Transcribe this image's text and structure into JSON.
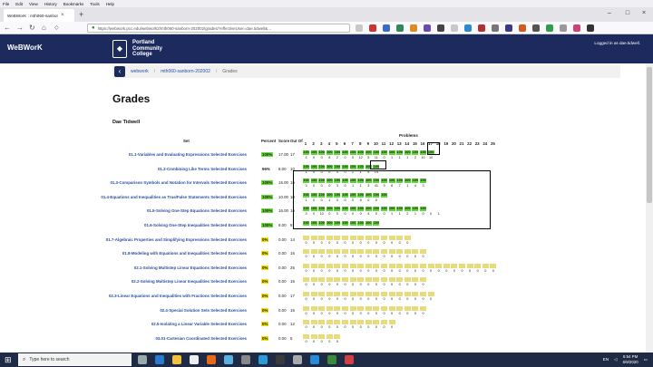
{
  "browser": {
    "menu": [
      "File",
      "Edit",
      "View",
      "History",
      "Bookmarks",
      "Tools",
      "Help"
    ],
    "tab_title": "WeBWorK : mth060-sanborn-2…",
    "url": "https://webwork.pcc.edu/webwork2/mth060-sanborn-202002/grades/?effectiveUser=dae.tidwell&…"
  },
  "header": {
    "app_name": "WeBWorK",
    "college": "Portland Community College",
    "logged_in": "Logged in as dae.tidwell."
  },
  "breadcrumb": {
    "home": "webwork",
    "course": "mth060-sanborn-202002",
    "current": "Grades"
  },
  "page": {
    "title": "Grades",
    "student": "Dae Tidwell",
    "problems_label": "Problems",
    "col_set": "Set",
    "col_percent": "Percent",
    "col_score": "Score",
    "col_outof": "Out Of",
    "problem_numbers": [
      "1",
      "2",
      "3",
      "4",
      "5",
      "6",
      "7",
      "8",
      "9",
      "10",
      "11",
      "12",
      "13",
      "14",
      "15",
      "16",
      "17",
      "18",
      "19",
      "20",
      "21",
      "22",
      "23",
      "24",
      "25"
    ]
  },
  "sets": [
    {
      "name": "01.1-Variables and Evaluating Expressions Selected Exercises",
      "pct": "100%",
      "score": "17.00",
      "outof": "17",
      "status": "hi",
      "row1": [
        "100",
        "100",
        "100",
        "100",
        "100",
        "100",
        "100",
        "100",
        "100",
        "100",
        "100",
        "100",
        "100",
        "100",
        "100",
        "100",
        "100"
      ],
      "row2": [
        "4",
        "0",
        "0",
        "8",
        "2",
        "0",
        "0",
        "12",
        "5",
        "11",
        "0",
        "1",
        "1",
        "1",
        "2",
        "10",
        "10"
      ]
    },
    {
      "name": "01.2-Combining Like Terms Selected Exercises",
      "pct": "96%",
      "score": "8.00",
      "outof": "10",
      "status": "mid",
      "row1": [
        "100",
        "100",
        "100",
        "100",
        "100",
        "100",
        "100",
        "100",
        "100",
        "100"
      ],
      "row2": [
        "1",
        "0",
        "0",
        "0",
        "0",
        "0",
        "2",
        "1",
        "5",
        "14"
      ]
    },
    {
      "name": "01.3-Comparison Symbols and Notation for Intervals Selected Exercises",
      "pct": "100%",
      "score": "16.00",
      "outof": "16",
      "status": "hi",
      "row1": [
        "100",
        "100",
        "100",
        "100",
        "100",
        "100",
        "100",
        "100",
        "100",
        "100",
        "100",
        "100",
        "100",
        "100",
        "100",
        "100"
      ],
      "row2": [
        "3",
        "0",
        "0",
        "0",
        "3",
        "0",
        "1",
        "1",
        "3",
        "41",
        "9",
        "8",
        "7",
        "1",
        "4",
        "3"
      ]
    },
    {
      "name": "01.4-Equations and Inequalities as True/False Statements Selected Exercises",
      "pct": "100%",
      "score": "10.00",
      "outof": "10",
      "status": "hi",
      "row1": [
        "100",
        "100",
        "100",
        "100",
        "100",
        "100",
        "100",
        "100",
        "100",
        "100",
        "100"
      ],
      "row2": [
        "1",
        "0",
        "0",
        "1",
        "0",
        "0",
        "0",
        "8",
        "0",
        "0"
      ]
    },
    {
      "name": "01.5-Solving One-Step Equations Selected Exercises",
      "pct": "100%",
      "score": "16.00",
      "outof": "16",
      "status": "hi",
      "row1": [
        "100",
        "100",
        "100",
        "100",
        "100",
        "100",
        "100",
        "100",
        "100",
        "100",
        "100",
        "100",
        "100",
        "100",
        "100",
        "100"
      ],
      "row2": [
        "3",
        "0",
        "10",
        "0",
        "0",
        "0",
        "0",
        "0",
        "4",
        "0",
        "0",
        "1",
        "1",
        "2",
        "1",
        "0",
        "0",
        "1"
      ]
    },
    {
      "name": "01.6-Solving One-Step Inequalities Selected Exercises",
      "pct": "100%",
      "score": "8.00",
      "outof": "8",
      "status": "hi",
      "row1": [
        "100",
        "100",
        "100",
        "100",
        "100",
        "100",
        "100",
        "100",
        "100",
        "100"
      ],
      "row2": []
    },
    {
      "name": "01.7-Algebraic Properties and Simplifying Expressions Selected Exercises",
      "pct": "0%",
      "score": "0.00",
      "outof": "14",
      "status": "lo",
      "row1": [
        "",
        "",
        "",
        "",
        "",
        "",
        "",
        "",
        "",
        "",
        "",
        "",
        "",
        ""
      ],
      "row2": [
        "0",
        "0",
        "0",
        "0",
        "0",
        "0",
        "0",
        "0",
        "0",
        "0",
        "0",
        "0",
        "0",
        "0"
      ]
    },
    {
      "name": "01.8-Modeling with Equations and Inequalities Selected Exercises",
      "pct": "0%",
      "score": "0.00",
      "outof": "16",
      "status": "lo",
      "row1": [
        "",
        "",
        "",
        "",
        "",
        "",
        "",
        "",
        "",
        "",
        "",
        "",
        "",
        "",
        "",
        ""
      ],
      "row2": [
        "0",
        "0",
        "0",
        "0",
        "0",
        "0",
        "0",
        "0",
        "0",
        "0",
        "0",
        "0",
        "0",
        "0",
        "0",
        "0"
      ]
    },
    {
      "name": "02.1-Solving Multistep Linear Equations Selected Exercises",
      "pct": "0%",
      "score": "0.00",
      "outof": "25",
      "status": "lo",
      "row1": [
        "",
        "",
        "",
        "",
        "",
        "",
        "",
        "",
        "",
        "",
        "",
        "",
        "",
        "",
        "",
        "",
        "",
        "",
        "",
        "",
        "",
        "",
        "",
        "",
        ""
      ],
      "row2": [
        "0",
        "0",
        "0",
        "0",
        "0",
        "0",
        "0",
        "0",
        "0",
        "0",
        "0",
        "0",
        "0",
        "0",
        "0",
        "0",
        "0",
        "0",
        "0",
        "0",
        "0",
        "0",
        "0",
        "0",
        "0"
      ]
    },
    {
      "name": "02.2-Solving Multistep Linear Inequalities Selected Exercises",
      "pct": "0%",
      "score": "0.00",
      "outof": "16",
      "status": "lo",
      "row1": [
        "",
        "",
        "",
        "",
        "",
        "",
        "",
        "",
        "",
        "",
        "",
        "",
        "",
        "",
        "",
        ""
      ],
      "row2": [
        "0",
        "0",
        "0",
        "0",
        "0",
        "0",
        "0",
        "0",
        "0",
        "0",
        "0",
        "0",
        "0",
        "0",
        "0",
        "0"
      ]
    },
    {
      "name": "02.3-Linear Equations and Inequalities with Fractions Selected Exercises",
      "pct": "0%",
      "score": "0.00",
      "outof": "17",
      "status": "lo",
      "row1": [
        "",
        "",
        "",
        "",
        "",
        "",
        "",
        "",
        "",
        "",
        "",
        "",
        "",
        "",
        "",
        "",
        ""
      ],
      "row2": [
        "0",
        "0",
        "0",
        "0",
        "0",
        "0",
        "0",
        "0",
        "0",
        "0",
        "0",
        "0",
        "0",
        "0",
        "0",
        "0",
        "0"
      ]
    },
    {
      "name": "02.4-Special Solution Sets Selected Exercises",
      "pct": "0%",
      "score": "0.00",
      "outof": "16",
      "status": "lo",
      "row1": [
        "",
        "",
        "",
        "",
        "",
        "",
        "",
        "",
        "",
        "",
        "",
        "",
        "",
        "",
        "",
        ""
      ],
      "row2": [
        "0",
        "0",
        "0",
        "0",
        "0",
        "0",
        "0",
        "0",
        "0",
        "0",
        "0",
        "0",
        "0",
        "0",
        "0",
        "0"
      ]
    },
    {
      "name": "02.5-Isolating a Linear Variable Selected Exercises",
      "pct": "0%",
      "score": "0.00",
      "outof": "12",
      "status": "lo",
      "row1": [
        "",
        "",
        "",
        "",
        "",
        "",
        "",
        "",
        "",
        "",
        "",
        ""
      ],
      "row2": [
        "0",
        "0",
        "0",
        "0",
        "0",
        "0",
        "0",
        "0",
        "0",
        "0",
        "0",
        "0"
      ]
    },
    {
      "name": "03.01-Cartesian Coordinated Selected Exercises",
      "pct": "0%",
      "score": "0.00",
      "outof": "5",
      "status": "lo",
      "row1": [
        "",
        "",
        "",
        "",
        ""
      ],
      "row2": [
        "0",
        "0",
        "0",
        "0",
        "0"
      ]
    }
  ],
  "taskbar": {
    "search_placeholder": "Type here to search",
    "lang": "EN",
    "time": "6:54 PM",
    "date": "6/9/2020"
  }
}
